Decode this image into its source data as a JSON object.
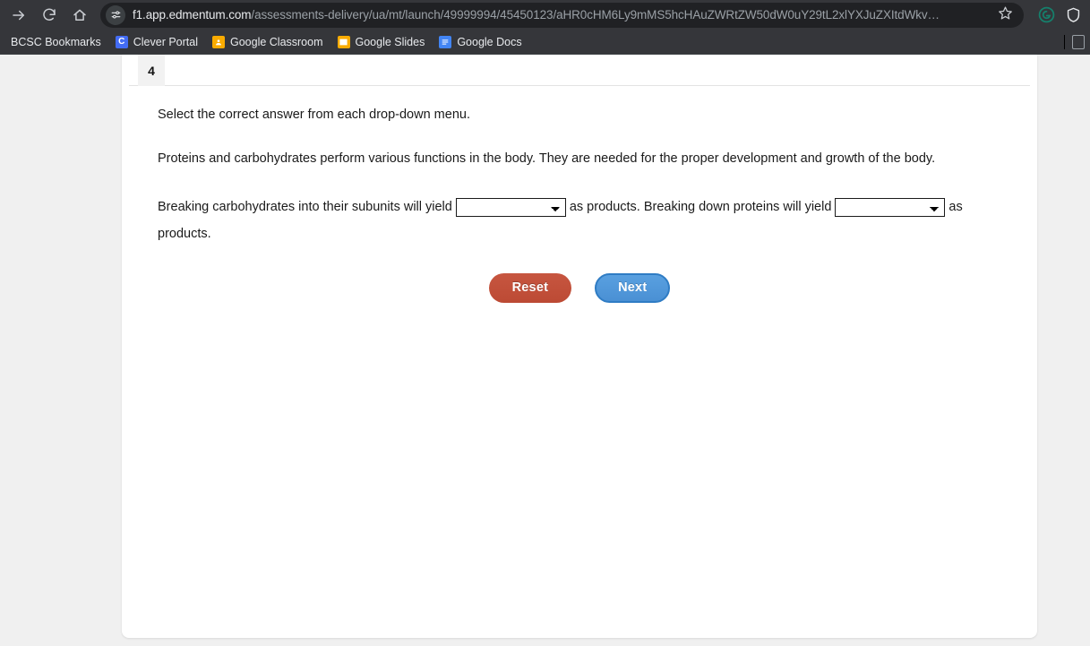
{
  "browser": {
    "nav": {
      "forward_icon": "arrow-right-icon",
      "reload_icon": "reload-icon",
      "home_icon": "home-icon"
    },
    "omnibox": {
      "site_settings_icon": "site-settings-icon",
      "url_host": "f1.app.edmentum.com",
      "url_path": "/assessments-delivery/ua/mt/launch/49999994/45450123/aHR0cHM6Ly9mMS5hcHAuZWRtZW50dW0uY29tL2xlYXJuZXItdWkv…",
      "bookmark_icon": "star-icon"
    },
    "extensions": [
      {
        "name": "grammarly-extension-icon",
        "label": "G",
        "color": "#15806c"
      },
      {
        "name": "shield-extension-icon",
        "label": "",
        "color": "#e8eaed"
      }
    ],
    "bookmarks": [
      {
        "label": "BCSC Bookmarks",
        "icon": "folder-icon",
        "has_favicon": false
      },
      {
        "label": "Clever Portal",
        "icon": "clever-favicon",
        "has_favicon": true,
        "glyph": "C",
        "color": "#436CF4"
      },
      {
        "label": "Google Classroom",
        "icon": "google-classroom-favicon",
        "has_favicon": true,
        "glyph": "",
        "color": "#F9AB00"
      },
      {
        "label": "Google Slides",
        "icon": "google-slides-favicon",
        "has_favicon": true,
        "glyph": "",
        "color": "#F9AB00"
      },
      {
        "label": "Google Docs",
        "icon": "google-docs-favicon",
        "has_favicon": true,
        "glyph": "",
        "color": "#4285F4"
      }
    ],
    "bookmarks_overflow_icon": "reading-list-icon"
  },
  "assessment": {
    "tab_number": "4",
    "instruction": "Select the correct answer from each drop-down menu.",
    "stem": "Proteins and carbohydrates perform various functions in the body. They are needed for the proper development and growth of the body.",
    "fill_in": {
      "part1": "Breaking carbohydrates into their subunits will yield",
      "part2": "as products. Breaking down proteins will yield",
      "part3": "as products."
    },
    "dropdown1": {
      "name": "carbohydrate-products-dropdown",
      "value": "",
      "placeholder": ""
    },
    "dropdown2": {
      "name": "protein-products-dropdown",
      "value": "",
      "placeholder": ""
    },
    "buttons": {
      "reset_label": "Reset",
      "next_label": "Next",
      "reset_color": "#bc4a34",
      "next_color": "#4a90d4"
    }
  }
}
